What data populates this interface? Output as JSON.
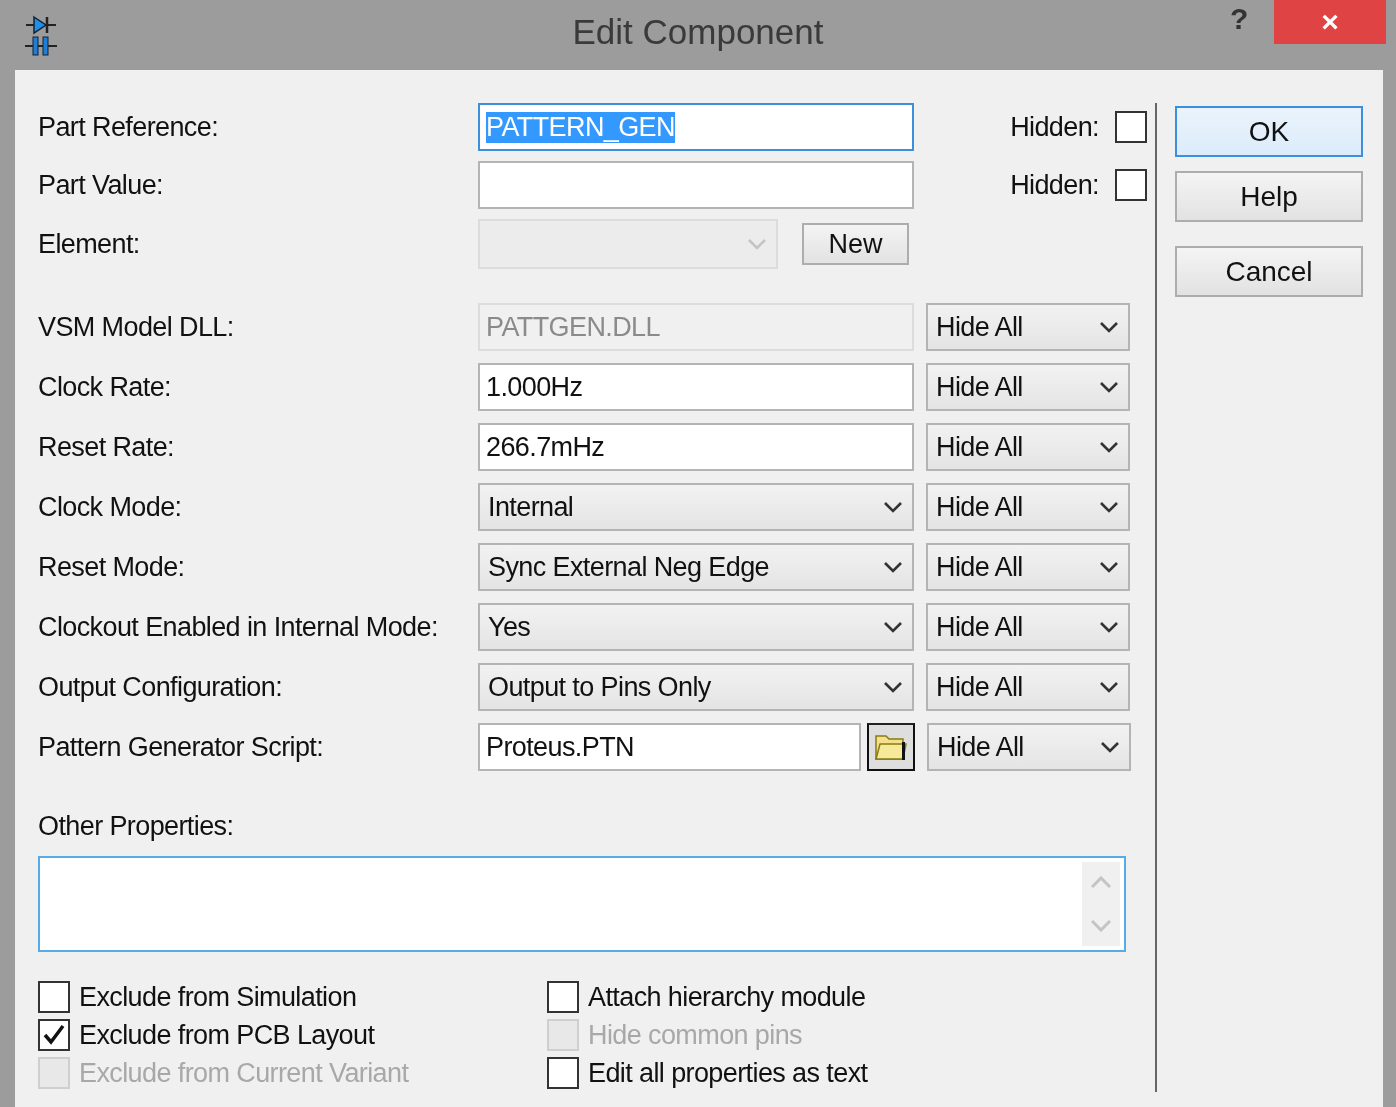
{
  "window": {
    "title": "Edit Component",
    "help_button": "?",
    "close_button": "×"
  },
  "top_fields": [
    {
      "kind": "text",
      "label": "Part Reference:",
      "value": "PATTERN_GEN",
      "focused": true,
      "hidden_label": "Hidden:",
      "hidden": false
    },
    {
      "kind": "text",
      "label": "Part Value:",
      "focused": false,
      "hidden_label": "Hidden:",
      "hidden": false
    },
    {
      "kind": "element",
      "label": "Element:",
      "disabled": true,
      "button": "New"
    }
  ],
  "properties": [
    {
      "kind": "readonly",
      "label": "VSM Model DLL:",
      "value": "PATTGEN.DLL",
      "visibility": "Hide All"
    },
    {
      "kind": "text",
      "label": "Clock Rate:",
      "value": "1.000Hz",
      "visibility": "Hide All"
    },
    {
      "kind": "text",
      "label": "Reset Rate:",
      "value": "266.7mHz",
      "visibility": "Hide All"
    },
    {
      "kind": "select",
      "label": "Clock Mode:",
      "value": "Internal",
      "visibility": "Hide All"
    },
    {
      "kind": "select",
      "label": "Reset Mode:",
      "value": "Sync External Neg Edge",
      "visibility": "Hide All"
    },
    {
      "kind": "select",
      "label": "Clockout Enabled in Internal Mode:",
      "value": "Yes",
      "visibility": "Hide All"
    },
    {
      "kind": "select",
      "label": "Output Configuration:",
      "value": "Output to Pins Only",
      "visibility": "Hide All"
    },
    {
      "kind": "file",
      "label": "Pattern Generator Script:",
      "value": "Proteus.PTN",
      "visibility": "Hide All"
    }
  ],
  "other_properties": {
    "label": "Other Properties:"
  },
  "options": {
    "left": [
      {
        "label": "Exclude from Simulation",
        "checked": false,
        "disabled": false
      },
      {
        "label": "Exclude from PCB Layout",
        "checked": true,
        "disabled": false
      },
      {
        "label": "Exclude from Current Variant",
        "checked": false,
        "disabled": true
      }
    ],
    "right": [
      {
        "label": "Attach hierarchy module",
        "checked": false,
        "disabled": false
      },
      {
        "label": "Hide common pins",
        "checked": false,
        "disabled": true
      },
      {
        "label": "Edit all properties as text",
        "checked": false,
        "disabled": false
      }
    ]
  },
  "buttons": [
    {
      "label": "OK",
      "default": true
    },
    {
      "label": "Help",
      "default": false
    },
    {
      "label": "Cancel",
      "default": false
    }
  ]
}
